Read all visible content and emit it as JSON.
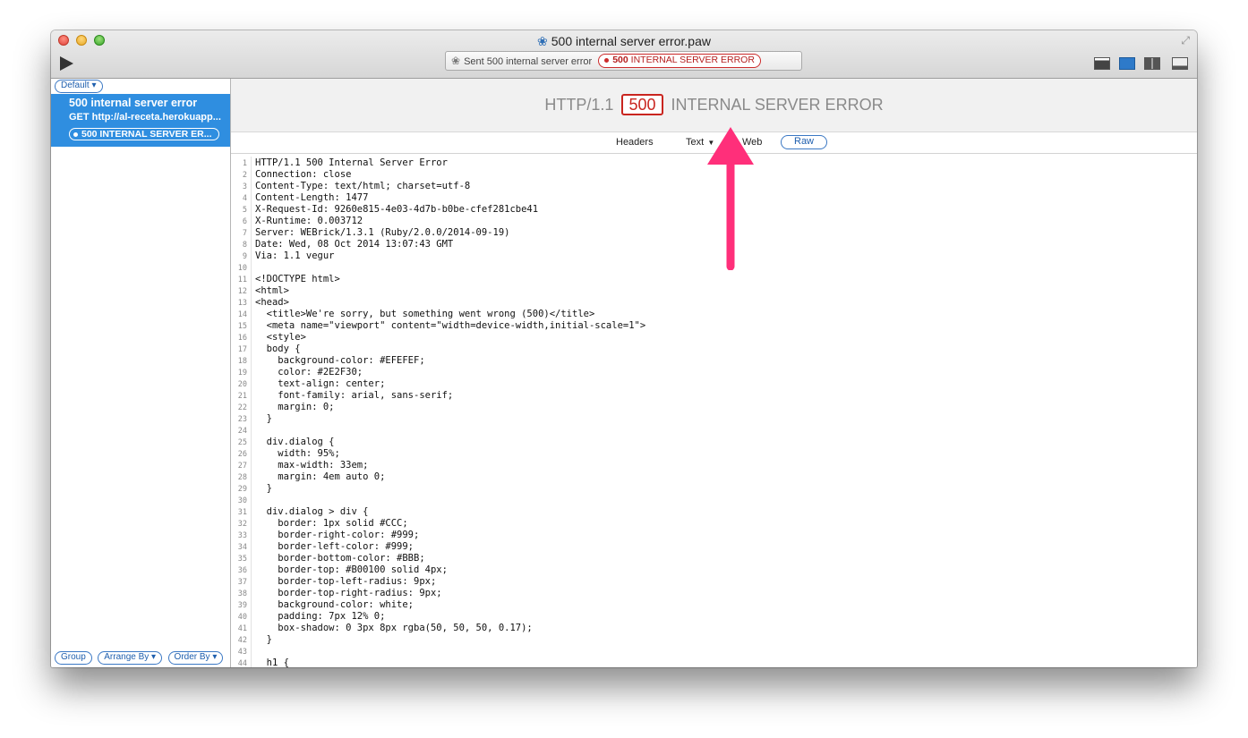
{
  "window": {
    "title": "500 internal server error.paw",
    "title_icon": "paw-icon"
  },
  "toolbar": {
    "status_sent": "Sent 500 internal server error",
    "status_code": "500",
    "status_text": "INTERNAL SERVER ERROR"
  },
  "sidebar": {
    "group_select": "Default",
    "request": {
      "name": "500 internal server error",
      "url": "GET  http://al-receta.herokuapp...",
      "status": "500 INTERNAL SERVER ER..."
    },
    "footer": [
      "Group",
      "Arrange By",
      "Order By"
    ]
  },
  "response": {
    "protocol": "HTTP/1.1",
    "code": "500",
    "reason": "INTERNAL SERVER ERROR",
    "tabs": {
      "headers": "Headers",
      "text": "Text",
      "web": "Web",
      "raw": "Raw"
    }
  },
  "code_lines": [
    "HTTP/1.1 500 Internal Server Error",
    "Connection: close",
    "Content-Type: text/html; charset=utf-8",
    "Content-Length: 1477",
    "X-Request-Id: 9260e815-4e03-4d7b-b0be-cfef281cbe41",
    "X-Runtime: 0.003712",
    "Server: WEBrick/1.3.1 (Ruby/2.0.0/2014-09-19)",
    "Date: Wed, 08 Oct 2014 13:07:43 GMT",
    "Via: 1.1 vegur",
    "",
    "<!DOCTYPE html>",
    "<html>",
    "<head>",
    "  <title>We're sorry, but something went wrong (500)</title>",
    "  <meta name=\"viewport\" content=\"width=device-width,initial-scale=1\">",
    "  <style>",
    "  body {",
    "    background-color: #EFEFEF;",
    "    color: #2E2F30;",
    "    text-align: center;",
    "    font-family: arial, sans-serif;",
    "    margin: 0;",
    "  }",
    "",
    "  div.dialog {",
    "    width: 95%;",
    "    max-width: 33em;",
    "    margin: 4em auto 0;",
    "  }",
    "",
    "  div.dialog > div {",
    "    border: 1px solid #CCC;",
    "    border-right-color: #999;",
    "    border-left-color: #999;",
    "    border-bottom-color: #BBB;",
    "    border-top: #B00100 solid 4px;",
    "    border-top-left-radius: 9px;",
    "    border-top-right-radius: 9px;",
    "    background-color: white;",
    "    padding: 7px 12% 0;",
    "    box-shadow: 0 3px 8px rgba(50, 50, 50, 0.17);",
    "  }",
    "",
    "  h1 {"
  ],
  "colors": {
    "selection": "#2f8ee0",
    "error_red": "#c9251f",
    "accent_blue": "#3b78c4",
    "arrow_pink": "#ff2f7a"
  }
}
